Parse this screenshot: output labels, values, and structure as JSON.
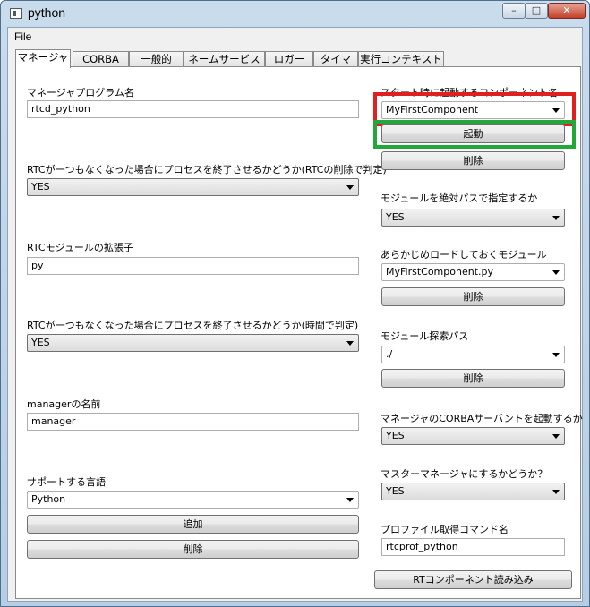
{
  "window": {
    "title": "python"
  },
  "titlebar_buttons": {
    "minimize": "–",
    "maximize": "□",
    "close": "✕"
  },
  "menu": {
    "file": "File"
  },
  "tabs": [
    {
      "label": "マネージャ",
      "active": true
    },
    {
      "label": "CORBA"
    },
    {
      "label": "一般的"
    },
    {
      "label": "ネームサービス"
    },
    {
      "label": "ロガー"
    },
    {
      "label": "タイマ"
    },
    {
      "label": "実行コンテキスト"
    }
  ],
  "left": {
    "program_name": {
      "label": "マネージャプログラム名",
      "value": "rtcd_python"
    },
    "shutdown_on_no_rtc": {
      "label": "RTCが一つもなくなった場合にプロセスを終了させるかどうか(RTCの削除で判定)",
      "value": "YES"
    },
    "rtc_module_ext": {
      "label": "RTCモジュールの拡張子",
      "value": "py"
    },
    "shutdown_by_time": {
      "label": "RTCが一つもなくなった場合にプロセスを終了させるかどうか(時間で判定)",
      "value": "YES"
    },
    "manager_name": {
      "label": "managerの名前",
      "value": "manager"
    },
    "languages": {
      "label": "サポートする言語",
      "value": "Python",
      "add": "追加",
      "delete": "削除"
    }
  },
  "right": {
    "startup_component": {
      "label": "スタート時に起動するコンポーネント名",
      "value": "MyFirstComponent",
      "launch": "起動",
      "delete": "削除"
    },
    "abs_path": {
      "label": "モジュールを絶対パスで指定するか",
      "value": "YES"
    },
    "preload": {
      "label": "あらかじめロードしておくモジュール",
      "value": "MyFirstComponent.py",
      "delete": "削除"
    },
    "search_path": {
      "label": "モジュール探索パス",
      "value": "./",
      "delete": "削除"
    },
    "corba_servant": {
      "label": "マネージャのCORBAサーバントを起動するか",
      "value": "YES"
    },
    "master": {
      "label": "マスターマネージャにするかどうか？",
      "value": "YES"
    },
    "profiler": {
      "label": "プロファイル取得コマンド名",
      "value": "rtcprof_python"
    },
    "load_button": "RTコンポーネント読み込み"
  }
}
